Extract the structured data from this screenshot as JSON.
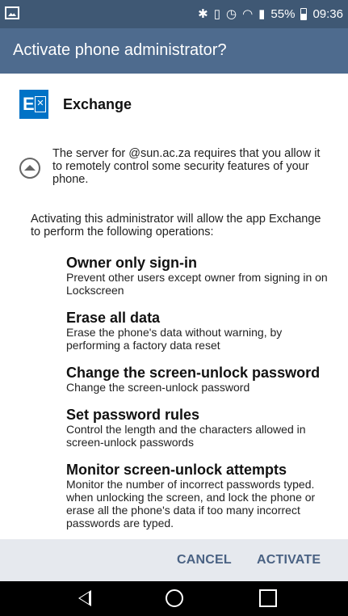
{
  "status_bar": {
    "battery": "55%",
    "time": "09:36",
    "icons": [
      "image-notification-icon",
      "bluetooth-icon",
      "vibrate-icon",
      "alarm-icon",
      "wifi-icon",
      "signal-icon",
      "battery-icon"
    ]
  },
  "dialog": {
    "title": "Activate phone administrator?",
    "app_name": "Exchange",
    "server_message": "The server for        @sun.ac.za requires that you allow it to remotely control some security features of your phone.",
    "intro": "Activating this administrator will allow the app Exchange to perform the following operations:",
    "operations": [
      {
        "title": "Owner only sign-in",
        "description": "Prevent other users except owner from signing in on Lockscreen"
      },
      {
        "title": "Erase all data",
        "description": "Erase the phone's data without warning, by performing a factory data reset"
      },
      {
        "title": "Change the screen-unlock password",
        "description": "Change the screen-unlock password"
      },
      {
        "title": "Set password rules",
        "description": "Control the length and the characters allowed in screen-unlock passwords"
      },
      {
        "title": "Monitor screen-unlock attempts",
        "description": "Monitor the number of incorrect passwords typed. when unlocking the screen, and lock the phone or erase all the phone's data if too many incorrect passwords are typed."
      }
    ],
    "cancel_label": "CANCEL",
    "activate_label": "ACTIVATE"
  },
  "colors": {
    "status_bar": "#3f5874",
    "title_bar": "#4e6b8e",
    "action_bar": "#e6e9ee",
    "button_text": "#4a6283",
    "exchange_blue": "#0072c6"
  }
}
